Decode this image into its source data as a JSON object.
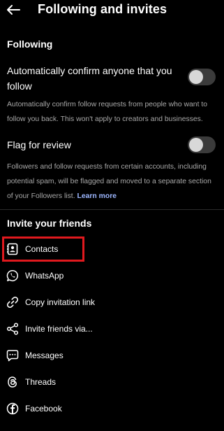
{
  "header": {
    "title": "Following and invites"
  },
  "following": {
    "section_title": "Following",
    "auto_confirm": {
      "title": "Automatically confirm anyone that you follow",
      "description": "Automatically confirm follow requests from people who want to follow you back. This won't apply to creators and businesses.",
      "enabled": false
    },
    "flag_review": {
      "title": "Flag for review",
      "description": "Followers and follow requests from certain accounts, including potential spam, will be flagged and moved to a separate section of your Followers list.",
      "learn_more": "Learn more",
      "enabled": false
    }
  },
  "invite": {
    "section_title": "Invite your friends",
    "items": [
      {
        "label": "Contacts",
        "icon": "contacts-icon"
      },
      {
        "label": "WhatsApp",
        "icon": "whatsapp-icon"
      },
      {
        "label": "Copy invitation link",
        "icon": "link-icon"
      },
      {
        "label": "Invite friends via...",
        "icon": "share-icon"
      },
      {
        "label": "Messages",
        "icon": "messages-icon"
      },
      {
        "label": "Threads",
        "icon": "threads-icon"
      },
      {
        "label": "Facebook",
        "icon": "facebook-icon"
      }
    ]
  },
  "colors": {
    "background": "#000000",
    "highlight": "#e0191e",
    "link": "#9db7ff",
    "muted_text": "#a8a8a8"
  }
}
